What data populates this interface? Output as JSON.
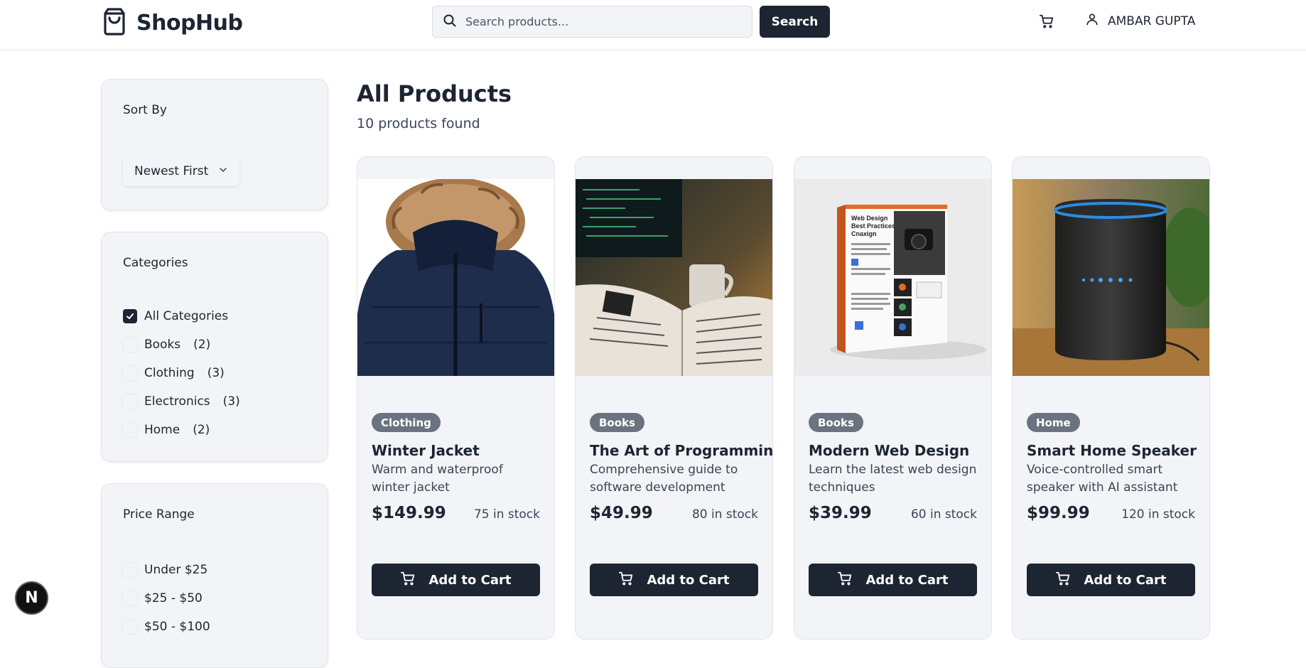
{
  "header": {
    "brand": "ShopHub",
    "search_placeholder": "Search products...",
    "search_button": "Search",
    "user_name": "AMBAR GUPTA"
  },
  "sidebar": {
    "sort": {
      "title": "Sort By",
      "selected": "Newest First"
    },
    "categories": {
      "title": "Categories",
      "items": [
        {
          "label": "All Categories",
          "count": "",
          "checked": true
        },
        {
          "label": "Books",
          "count": "(2)",
          "checked": false
        },
        {
          "label": "Clothing",
          "count": "(3)",
          "checked": false
        },
        {
          "label": "Electronics",
          "count": "(3)",
          "checked": false
        },
        {
          "label": "Home",
          "count": "(2)",
          "checked": false
        }
      ]
    },
    "price": {
      "title": "Price Range",
      "items": [
        {
          "label": "Under $25",
          "checked": false
        },
        {
          "label": "$25 - $50",
          "checked": false
        },
        {
          "label": "$50 - $100",
          "checked": false
        }
      ]
    }
  },
  "main": {
    "title": "All Products",
    "count_text": "10 products found",
    "products": [
      {
        "category": "Clothing",
        "name": "Winter Jacket",
        "description": "Warm and waterproof winter jacket",
        "price": "$149.99",
        "stock": "75 in stock",
        "button": "Add to Cart"
      },
      {
        "category": "Books",
        "name": "The Art of Programming",
        "description": "Comprehensive guide to software development",
        "price": "$49.99",
        "stock": "80 in stock",
        "button": "Add to Cart"
      },
      {
        "category": "Books",
        "name": "Modern Web Design",
        "description": "Learn the latest web design techniques",
        "price": "$39.99",
        "stock": "60 in stock",
        "button": "Add to Cart"
      },
      {
        "category": "Home",
        "name": "Smart Home Speaker",
        "description": "Voice-controlled smart speaker with AI assistant",
        "price": "$99.99",
        "stock": "120 in stock",
        "button": "Add to Cart"
      }
    ]
  },
  "dev_badge": "N",
  "colors": {
    "primary": "#1e2532",
    "panel_bg": "#f2f4f7",
    "badge": "#6b7280"
  },
  "book_cover": {
    "title_lines": [
      "Web Design",
      "Best Practices",
      "Cnaxign"
    ]
  }
}
